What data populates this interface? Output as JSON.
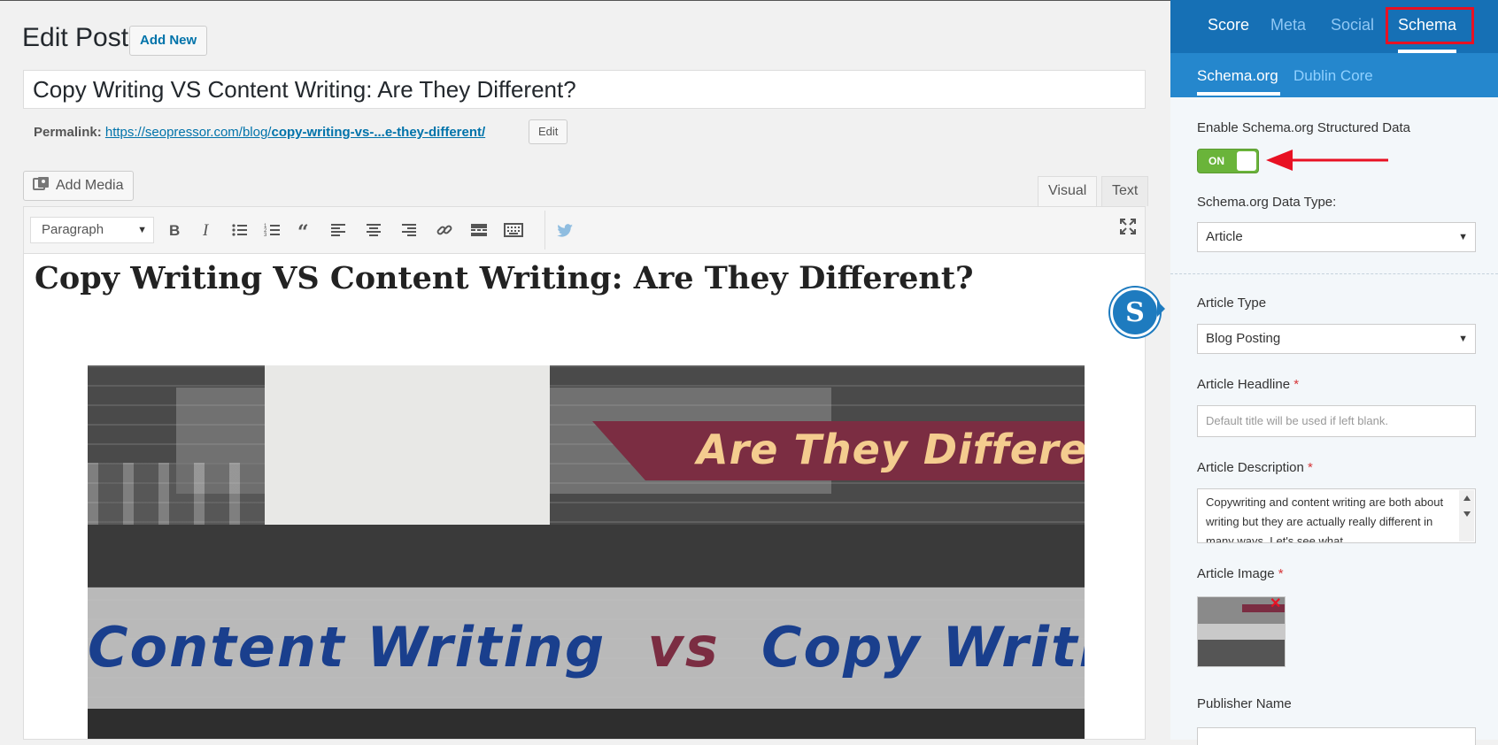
{
  "editor": {
    "page_title": "Edit Post",
    "add_new_label": "Add New",
    "post_title": "Copy Writing VS Content Writing: Are They Different?",
    "permalink_label": "Permalink:",
    "permalink_base": "https://seopressor.com/blog/",
    "permalink_slug": "copy-writing-vs-...e-they-different/",
    "edit_label": "Edit",
    "add_media_label": "Add Media",
    "tab_visual": "Visual",
    "tab_text": "Text",
    "format_select": "Paragraph",
    "content_heading": "Copy Writing VS Content Writing: Are They Different?",
    "image_banner_text": "Are They Different?",
    "image_text_left": "Content Writing",
    "image_text_vs": "vs",
    "image_text_right": "Copy Writing"
  },
  "toolbar_icons": [
    "bold-icon",
    "italic-icon",
    "bullet-list-icon",
    "numbered-list-icon",
    "blockquote-icon",
    "align-left-icon",
    "align-center-icon",
    "align-right-icon",
    "link-icon",
    "read-more-icon",
    "toolbar-toggle-icon",
    "twitter-bird-icon",
    "fullscreen-icon"
  ],
  "sidebar": {
    "tabs": [
      "Score",
      "Meta",
      "Social",
      "Schema"
    ],
    "active_tab": "Schema",
    "sub_tabs": [
      "Schema.org",
      "Dublin Core"
    ],
    "enable_label": "Enable Schema.org Structured Data",
    "toggle_state": "ON",
    "data_type_label": "Schema.org Data Type:",
    "data_type_value": "Article",
    "article_type_label": "Article Type",
    "article_type_value": "Blog Posting",
    "headline_label": "Article Headline",
    "headline_placeholder": "Default title will be used if left blank.",
    "description_label": "Article Description",
    "description_value": "Copywriting and content writing are both about writing but they are actually really different in many ways. Let's see what",
    "image_label": "Article Image",
    "publisher_label": "Publisher Name",
    "required_mark": "*"
  },
  "colors": {
    "sidebar_tabs_bg": "#1670b5",
    "sidebar_subtabs_bg": "#2587cd",
    "highlight_red": "#e81123",
    "toggle_green": "#6ab43a",
    "link_blue": "#0073aa"
  }
}
